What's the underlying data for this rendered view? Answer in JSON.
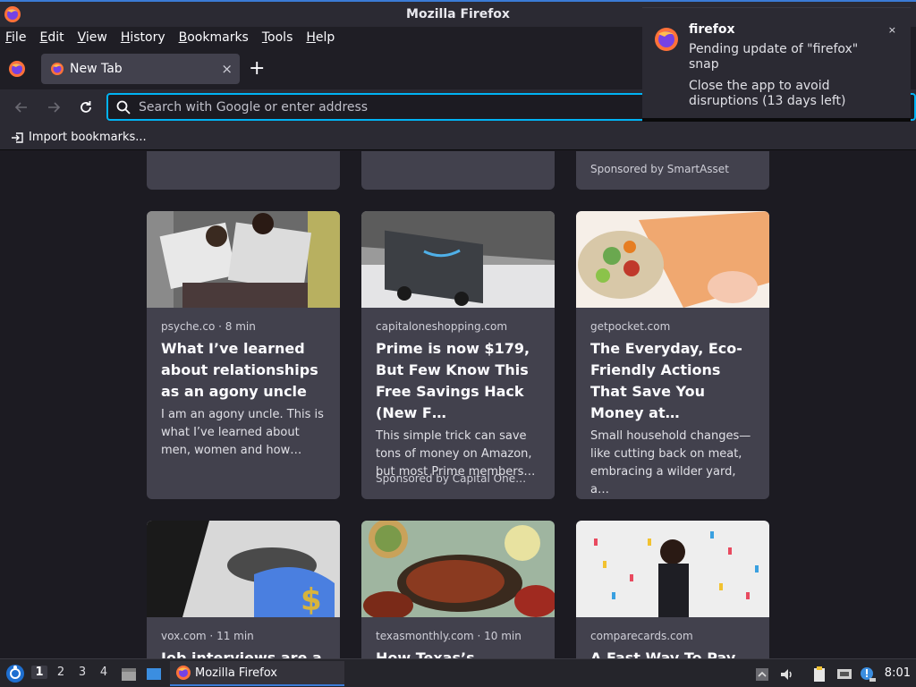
{
  "window": {
    "title": "Mozilla Firefox"
  },
  "menubar": {
    "items": [
      "File",
      "Edit",
      "View",
      "History",
      "Bookmarks",
      "Tools",
      "Help"
    ]
  },
  "tabs": {
    "active_label": "New Tab",
    "close_symbol": "×",
    "new_tab_symbol": "+"
  },
  "navbar": {
    "url_placeholder": "Search with Google or enter address",
    "url_value": ""
  },
  "bookmarks": {
    "import_label": "Import bookmarks..."
  },
  "content": {
    "top_partial_sponsor": "Sponsored by SmartAsset",
    "cards": [
      {
        "source": "psyche.co · 8 min",
        "headline": "What I’ve learned about relationships as an agony uncle",
        "excerpt": "I am an agony uncle. This is what I’ve learned about men, women and how…",
        "sponsor": ""
      },
      {
        "source": "capitaloneshopping.com",
        "headline": "Prime is now $179, But Few Know This Free Savings Hack (New F…",
        "excerpt": "This simple trick can save tons of money on Amazon, but most Prime members…",
        "sponsor": "Sponsored by Capital One…"
      },
      {
        "source": "getpocket.com",
        "headline": "The Everyday, Eco-Friendly Actions That Save You Money at…",
        "excerpt": "Small household changes—like cutting back on meat, embracing a wilder yard, a…",
        "sponsor": ""
      },
      {
        "source": "vox.com · 11 min",
        "headline": "Job interviews are a",
        "excerpt": "",
        "sponsor": ""
      },
      {
        "source": "texasmonthly.com · 10 min",
        "headline": "How Texas’s Mexican",
        "excerpt": "",
        "sponsor": ""
      },
      {
        "source": "comparecards.com",
        "headline": "A Fast Way To Pay Off",
        "excerpt": "",
        "sponsor": ""
      }
    ]
  },
  "notification": {
    "app": "firefox",
    "line1": "Pending update of \"firefox\" snap",
    "line2": "Close the app to avoid disruptions (13 days left)",
    "close_symbol": "×"
  },
  "taskbar": {
    "workspaces": [
      "1",
      "2",
      "3",
      "4"
    ],
    "active_workspace": "1",
    "task_label": "Mozilla Firefox",
    "clock": "8:01"
  }
}
